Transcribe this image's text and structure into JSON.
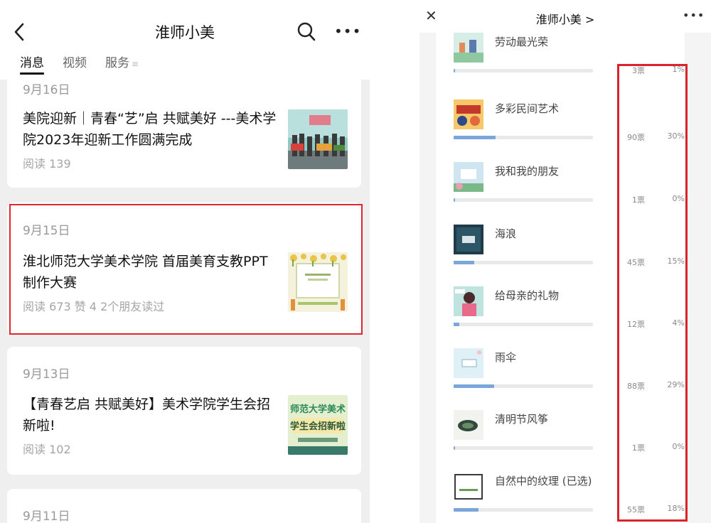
{
  "left": {
    "title": "淮师小美",
    "tabs": [
      {
        "label": "消息",
        "active": true
      },
      {
        "label": "视频",
        "active": false
      },
      {
        "label": "服务",
        "active": false
      }
    ],
    "articles": [
      {
        "date": "9月16日",
        "title": "美院迎新｜青春“艺”启 共赋美好 ---美术学院2023年迎新工作圆满完成",
        "meta": "阅读 139"
      },
      {
        "date": "9月15日",
        "title": "淮北师范大学美术学院 首届美育支教PPT制作大赛",
        "meta": "阅读 673  赞 4  2个朋友读过"
      },
      {
        "date": "9月13日",
        "title": "【青春艺启 共赋美好】美术学院学生会招新啦!",
        "meta": "阅读 102",
        "thumb_top": "师范大学美术",
        "thumb_bottom": "学生会招新啦"
      },
      {
        "date": "9月11日"
      }
    ]
  },
  "right": {
    "title": "淮师小美 >",
    "options": [
      {
        "name": "劳动最光荣",
        "votes": "3票",
        "percent": "1%",
        "fill_fraction": 0.01
      },
      {
        "name": "多彩民间艺术",
        "votes": "90票",
        "percent": "30%",
        "fill_fraction": 0.3
      },
      {
        "name": "我和我的朋友",
        "votes": "1票",
        "percent": "0%",
        "fill_fraction": 0.0
      },
      {
        "name": "海浪",
        "votes": "45票",
        "percent": "15%",
        "fill_fraction": 0.15
      },
      {
        "name": "给母亲的礼物",
        "votes": "12票",
        "percent": "4%",
        "fill_fraction": 0.04
      },
      {
        "name": "雨伞",
        "votes": "88票",
        "percent": "29%",
        "fill_fraction": 0.29
      },
      {
        "name": "清明节风筝",
        "votes": "1票",
        "percent": "0%",
        "fill_fraction": 0.0
      },
      {
        "name": "自然中的纹理 (已选)",
        "votes": "55票",
        "percent": "18%",
        "fill_fraction": 0.18
      }
    ]
  },
  "colors": {
    "highlight": "#e0262e",
    "bar_fill": "#7aa6dc",
    "bar_track": "#e9e9e9"
  },
  "icons": [
    "back-arrow-icon",
    "search-icon",
    "more-icon",
    "close-icon"
  ]
}
